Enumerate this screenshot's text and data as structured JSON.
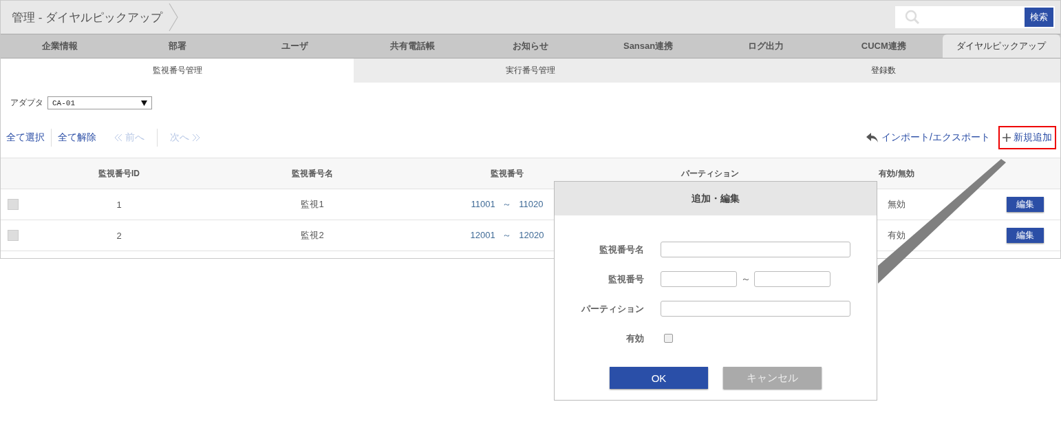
{
  "title": "管理 - ダイヤルピックアップ",
  "search": {
    "button": "検索"
  },
  "tabs": [
    {
      "label": "企業情報",
      "selected": false
    },
    {
      "label": "部署",
      "selected": false
    },
    {
      "label": "ユーザ",
      "selected": false
    },
    {
      "label": "共有電話帳",
      "selected": false
    },
    {
      "label": "お知らせ",
      "selected": false
    },
    {
      "label": "Sansan連携",
      "selected": false
    },
    {
      "label": "ログ出力",
      "selected": false
    },
    {
      "label": "CUCM連携",
      "selected": false
    },
    {
      "label": "ダイヤルピックアップ",
      "selected": true
    }
  ],
  "subtabs": [
    {
      "label": "監視番号管理",
      "selected": true
    },
    {
      "label": "実行番号管理",
      "selected": false
    },
    {
      "label": "登録数",
      "selected": false
    }
  ],
  "adapter": {
    "label": "アダプタ",
    "value": "CA-01"
  },
  "toolbar": {
    "select_all": "全て選択",
    "clear_all": "全て解除",
    "prev": {
      "label": "前へ",
      "disabled": true
    },
    "next": {
      "label": "次へ",
      "disabled": true
    },
    "import_export": "インポート/エクスポート",
    "add_new": {
      "label": "新規追加",
      "highlighted": true
    }
  },
  "table": {
    "columns": [
      "監視番号ID",
      "監視番号名",
      "監視番号",
      "パーティション",
      "有効/無効"
    ],
    "rows": [
      {
        "checked": false,
        "id": "1",
        "name": "監視1",
        "from": "11001",
        "sep": "～",
        "to": "11020",
        "status": "無効",
        "edit": "編集"
      },
      {
        "checked": false,
        "id": "2",
        "name": "監視2",
        "from": "12001",
        "sep": "～",
        "to": "12020",
        "status": "有効",
        "edit": "編集"
      }
    ]
  },
  "dialog": {
    "title": "追加・編集",
    "fields": [
      {
        "kind": "text",
        "label": "監視番号名"
      },
      {
        "kind": "range",
        "label": "監視番号",
        "sep": "～"
      },
      {
        "kind": "text",
        "label": "パーティション"
      },
      {
        "kind": "checkbox",
        "label": "有効",
        "checked": false
      }
    ],
    "buttons": [
      {
        "kind": "primary",
        "label": "OK"
      },
      {
        "kind": "secondary",
        "label": "キャンセル"
      }
    ]
  }
}
